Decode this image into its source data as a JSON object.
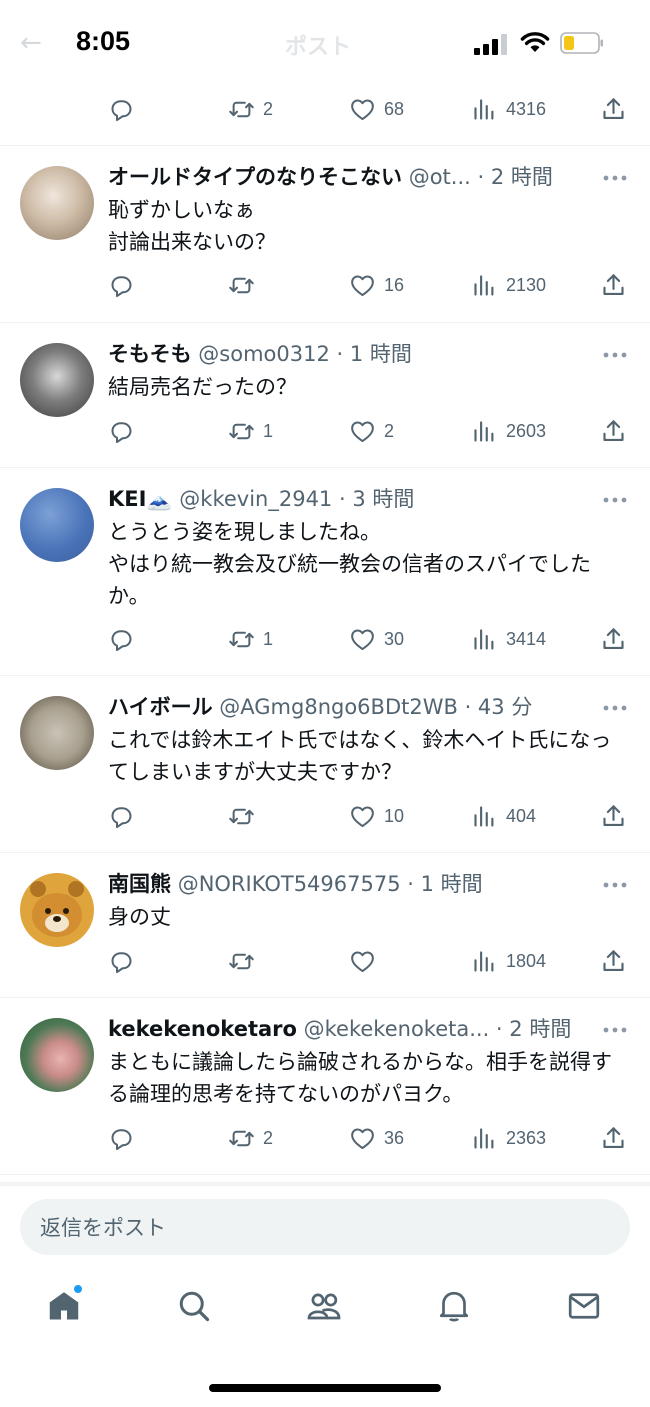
{
  "status_bar": {
    "time": "8:05"
  },
  "header": {
    "back": "←",
    "title": "ポスト"
  },
  "top_actions": {
    "retweets": "2",
    "likes": "68",
    "views": "4316"
  },
  "tweets": [
    {
      "name": "オールドタイプのなりそこない",
      "handle_time": "@ot... · 2 時間",
      "text": "恥ずかしいなぁ\n討論出来ないの？",
      "replies": "",
      "retweets": "",
      "likes": "16",
      "views": "2130"
    },
    {
      "name": "そもそも",
      "handle_time": "@somo0312 · 1 時間",
      "text": "結局売名だったの？",
      "replies": "",
      "retweets": "1",
      "likes": "2",
      "views": "2603"
    },
    {
      "name": "KEI🗻",
      "handle_time": "@kkevin_2941 · 3 時間",
      "text": "とうとう姿を現しましたね。\nやはり統一教会及び統一教会の信者のスパイでしたか。",
      "replies": "",
      "retweets": "1",
      "likes": "30",
      "views": "3414"
    },
    {
      "name": "ハイボール",
      "handle_time": "@AGmg8ngo6BDt2WB · 43 分",
      "text": "これでは鈴木エイト氏ではなく、鈴木ヘイト氏になってしまいますが大丈夫ですか？",
      "replies": "",
      "retweets": "",
      "likes": "10",
      "views": "404"
    },
    {
      "name": "南国熊",
      "handle_time": "@NORIKOT54967575 · 1 時間",
      "text": "身の丈",
      "replies": "",
      "retweets": "",
      "likes": "",
      "views": "1804"
    },
    {
      "name": "kekekenoketaro",
      "handle_time": "@kekekenoketa... · 2 時間",
      "text": "まともに議論したら論破されるからな。相手を説得する論理的思考を持てないのがパヨク。",
      "replies": "",
      "retweets": "2",
      "likes": "36",
      "views": "2363"
    }
  ],
  "reply_input": {
    "placeholder": "返信をポスト"
  },
  "tabbar": {
    "tabs": [
      "home-icon",
      "search-icon",
      "communities-icon",
      "notifications-icon",
      "messages-icon"
    ]
  },
  "colors": {
    "text": "#0f1419",
    "secondary": "#536471",
    "accent": "#1d9bf0",
    "divider": "#eff3f4"
  }
}
